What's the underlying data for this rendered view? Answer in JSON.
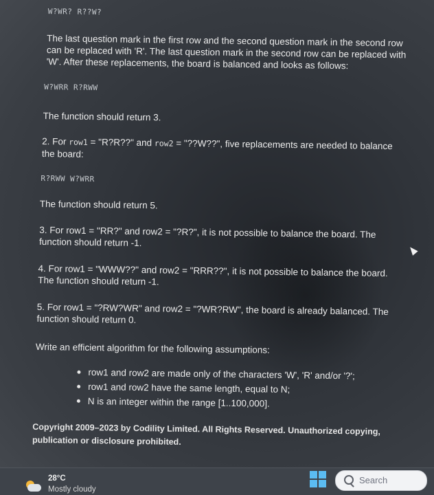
{
  "problem": {
    "ex1_board": "W?WR? R??W?",
    "ex1_expl": "The last question mark in the first row and the second question mark in the second row can be replaced with 'R'. The last question mark in the second row can be replaced with 'W'. After these replacements, the board is balanced and looks as follows:",
    "ex1_balanced": "W?WRR R?RWW",
    "ex1_return": "The function should return 3.",
    "ex2_text_a": "2. For ",
    "ex2_row1_name": "row1",
    "ex2_eq1": " = \"R?R??\" and ",
    "ex2_row2_name": "row2",
    "ex2_text_b": " = \"??W??\", five replacements are needed to balance the board:",
    "ex2_balanced": "R?RWW W?WRR",
    "ex2_return": "The function should return 5.",
    "ex3_text": "3. For row1 = \"RR?\" and row2 = \"?R?\", it is not possible to balance the board. The function should return -1.",
    "ex4_text": "4. For row1 = \"WWW??\" and row2 = \"RRR??\", it is not possible to balance the board. The function should return -1.",
    "ex5_text": "5. For row1 = \"?RW?WR\" and row2 = \"?WR?RW\", the board is already balanced. The function should return 0.",
    "assumptions_title": "Write an efficient algorithm for the following assumptions:",
    "assumptions": [
      "row1 and row2 are made only of the characters 'W', 'R' and/or '?';",
      "row1 and row2 have the same length, equal to N;",
      "N is an integer within the range [1..100,000]."
    ],
    "copyright": "Copyright 2009–2023 by Codility Limited. All Rights Reserved. Unauthorized copying, publication or disclosure prohibited."
  },
  "taskbar": {
    "temperature": "28°C",
    "condition": "Mostly cloudy",
    "search_label": "Search",
    "weather_icon": "partly-cloudy-icon",
    "start_icon": "windows-logo-icon",
    "search_icon": "search-icon"
  },
  "colors": {
    "windows_accent": "#5bbcf2",
    "sun": "#f3b63a"
  }
}
